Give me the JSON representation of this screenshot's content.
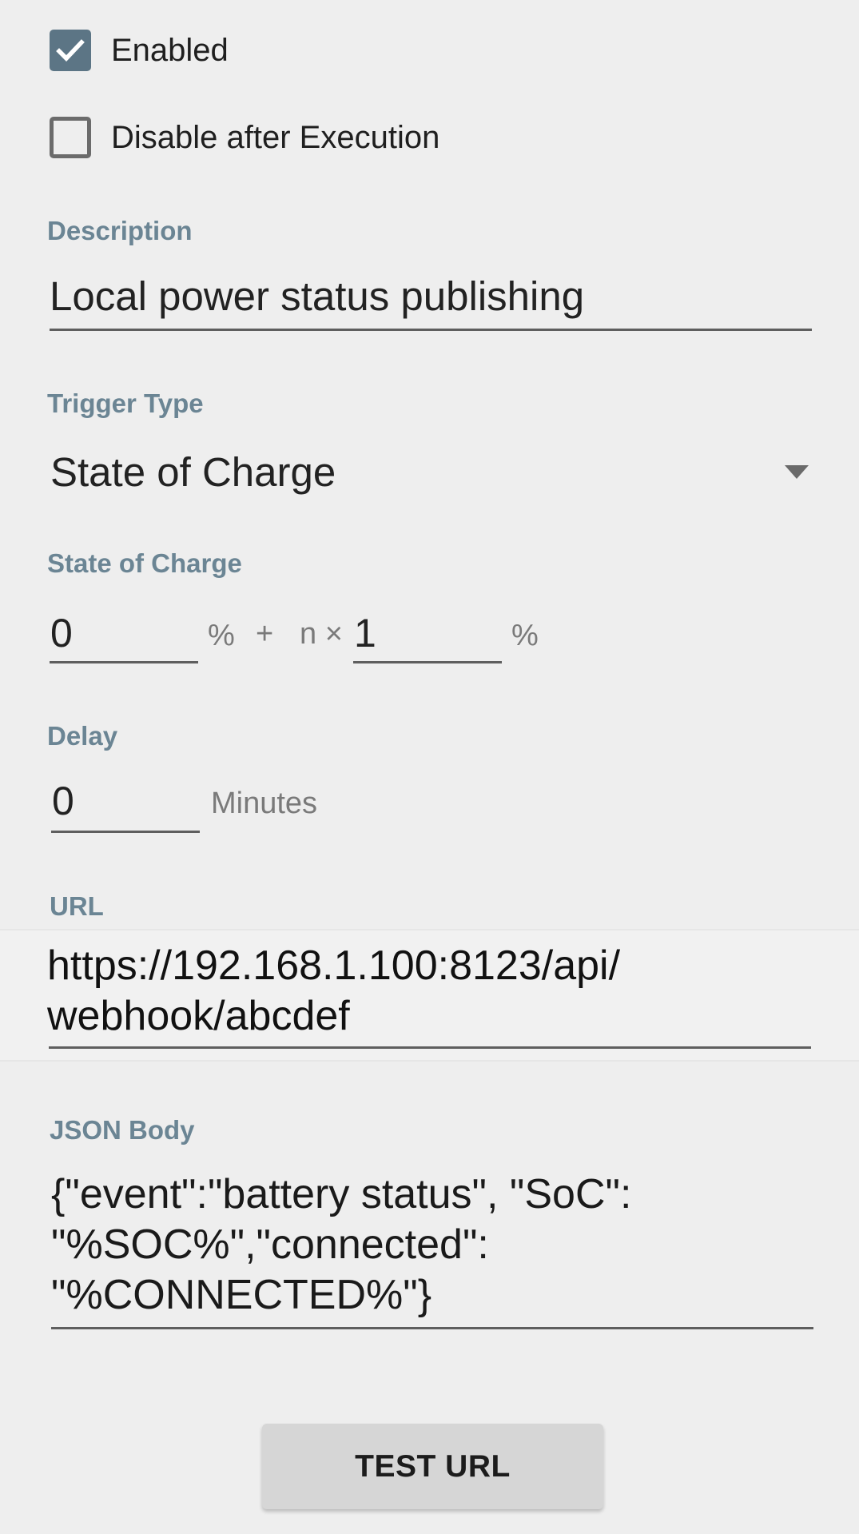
{
  "enabled": {
    "label": "Enabled",
    "checked": true
  },
  "disable_after_execution": {
    "label": "Disable after Execution",
    "checked": false
  },
  "description": {
    "label": "Description",
    "value": "Local power status publishing"
  },
  "trigger_type": {
    "label": "Trigger Type",
    "value": "State of Charge"
  },
  "state_of_charge": {
    "label": "State of Charge",
    "base_value": "0",
    "base_unit": "%",
    "plus": "+",
    "multiplier": "n ×",
    "step_value": "1",
    "step_unit": "%"
  },
  "delay": {
    "label": "Delay",
    "value": "0",
    "unit": "Minutes"
  },
  "url": {
    "label": "URL",
    "value": "https://192.168.1.100:8123/api/\nwebhook/abcdef"
  },
  "json_body": {
    "label": "JSON Body",
    "value": "{\"event\":\"battery status\", \"SoC\":\n\"%SOC%\",\"connected\":\n\"%CONNECTED%\"}"
  },
  "test_button": {
    "label": "TEST URL"
  },
  "colors": {
    "accent": "#5c7585",
    "label": "#6b8594",
    "background": "#eeeeee"
  },
  "icons": {
    "checkbox_checked": "check-icon",
    "dropdown": "dropdown-arrow-icon"
  }
}
